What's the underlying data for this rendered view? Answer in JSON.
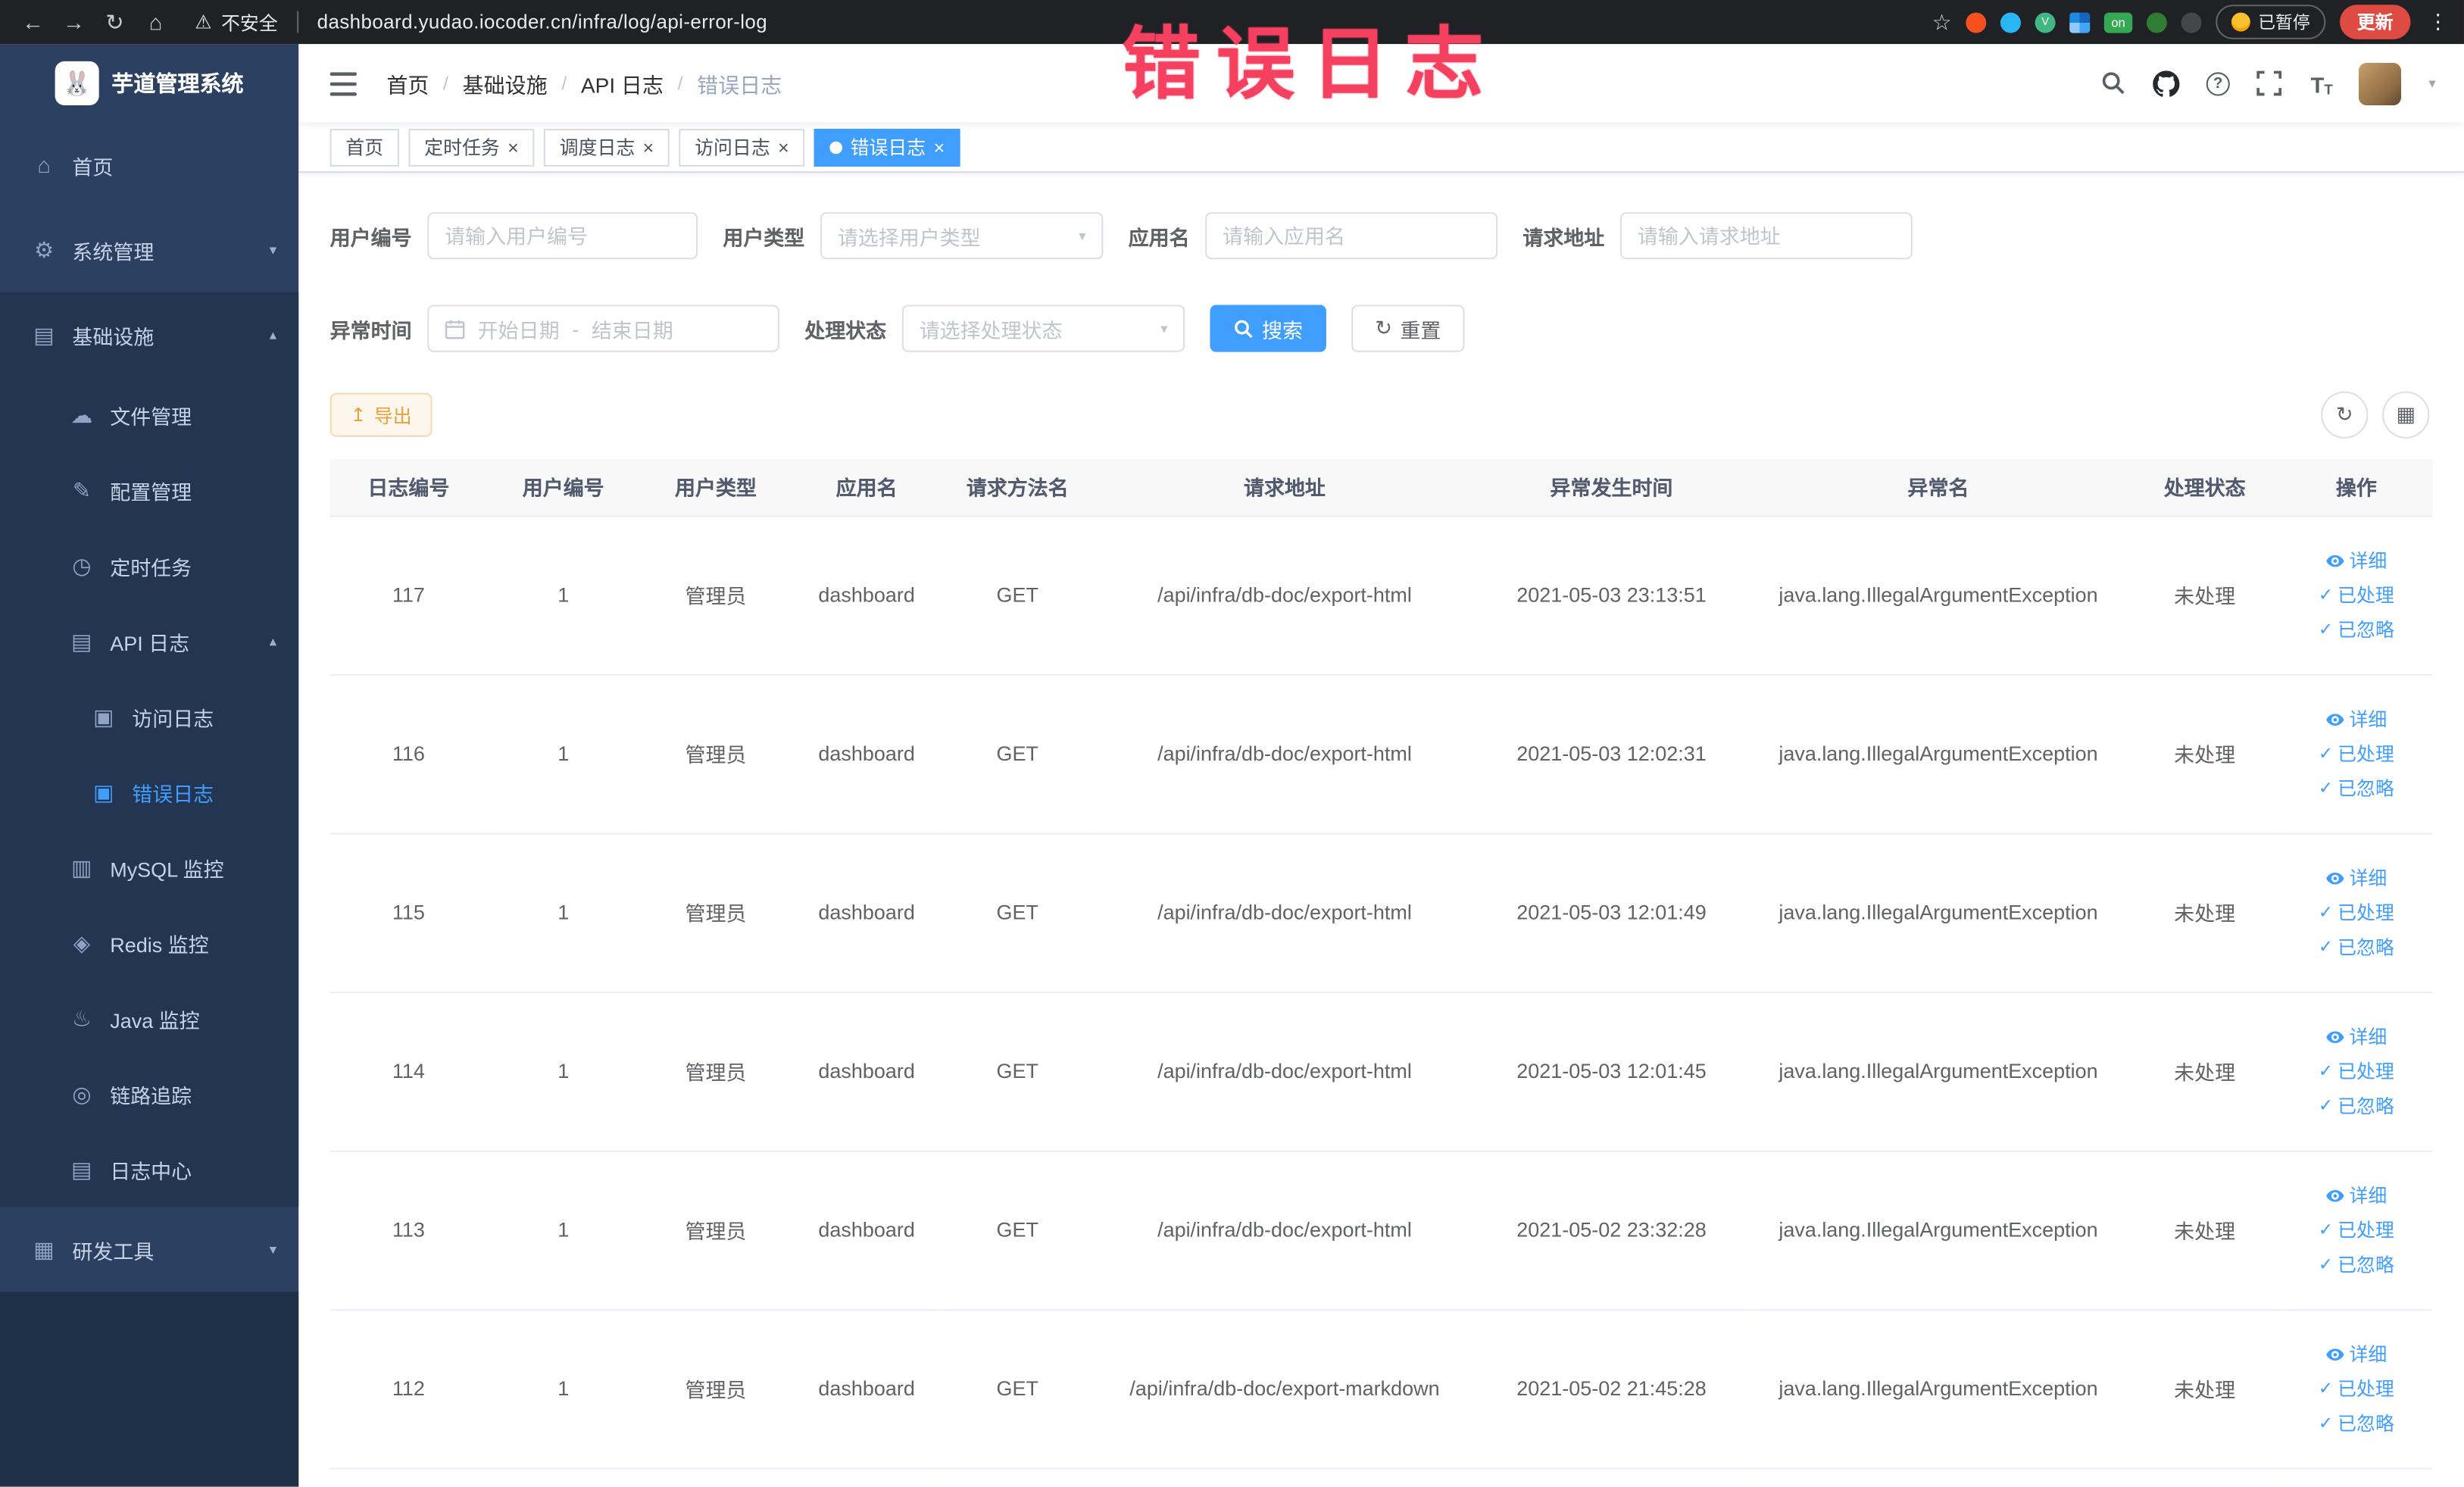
{
  "colors": {
    "accent": "#409eff",
    "annotation": "#f5405f",
    "warning": "#e6a23c",
    "sidebar_bg": "#2c4061"
  },
  "annotation": {
    "text": "错误日志"
  },
  "browser": {
    "security_label": "不安全",
    "url": "dashboard.yudao.iocoder.cn/infra/log/api-error-log",
    "ext_on": "on",
    "paused_label": "已暂停",
    "update_label": "更新"
  },
  "sidebar": {
    "logo_title": "芋道管理系统",
    "home": "首页",
    "system": "系统管理",
    "infra": "基础设施",
    "file": "文件管理",
    "config": "配置管理",
    "job": "定时任务",
    "api_log": "API 日志",
    "access_log": "访问日志",
    "error_log": "错误日志",
    "mysql": "MySQL 监控",
    "redis": "Redis 监控",
    "java": "Java 监控",
    "trace": "链路追踪",
    "log_center": "日志中心",
    "devtools": "研发工具"
  },
  "header": {
    "breadcrumb": [
      "首页",
      "基础设施",
      "API 日志",
      "错误日志"
    ]
  },
  "tabs": {
    "items": [
      {
        "label": "首页"
      },
      {
        "label": "定时任务"
      },
      {
        "label": "调度日志"
      },
      {
        "label": "访问日志"
      },
      {
        "label": "错误日志"
      }
    ]
  },
  "filters": {
    "user_id": {
      "label": "用户编号",
      "placeholder": "请输入用户编号",
      "value": ""
    },
    "user_type": {
      "label": "用户类型",
      "placeholder": "请选择用户类型"
    },
    "app_name": {
      "label": "应用名",
      "placeholder": "请输入应用名",
      "value": ""
    },
    "request_url": {
      "label": "请求地址",
      "placeholder": "请输入请求地址",
      "value": ""
    },
    "exception_time": {
      "label": "异常时间",
      "start_placeholder": "开始日期",
      "separator": "-",
      "end_placeholder": "结束日期"
    },
    "process_status": {
      "label": "处理状态",
      "placeholder": "请选择处理状态"
    },
    "search_label": "搜索",
    "reset_label": "重置"
  },
  "toolbar": {
    "export_label": "导出"
  },
  "table": {
    "columns": [
      "日志编号",
      "用户编号",
      "用户类型",
      "应用名",
      "请求方法名",
      "请求地址",
      "异常发生时间",
      "异常名",
      "处理状态",
      "操作"
    ],
    "action_labels": {
      "detail": "详细",
      "processed": "已处理",
      "ignored": "已忽略"
    },
    "rows": [
      {
        "id": "117",
        "user_id": "1",
        "user_type": "管理员",
        "app": "dashboard",
        "method": "GET",
        "url": "/api/infra/db-doc/export-html",
        "time": "2021-05-03 23:13:51",
        "exception": "java.lang.IllegalArgumentException",
        "status": "未处理"
      },
      {
        "id": "116",
        "user_id": "1",
        "user_type": "管理员",
        "app": "dashboard",
        "method": "GET",
        "url": "/api/infra/db-doc/export-html",
        "time": "2021-05-03 12:02:31",
        "exception": "java.lang.IllegalArgumentException",
        "status": "未处理"
      },
      {
        "id": "115",
        "user_id": "1",
        "user_type": "管理员",
        "app": "dashboard",
        "method": "GET",
        "url": "/api/infra/db-doc/export-html",
        "time": "2021-05-03 12:01:49",
        "exception": "java.lang.IllegalArgumentException",
        "status": "未处理"
      },
      {
        "id": "114",
        "user_id": "1",
        "user_type": "管理员",
        "app": "dashboard",
        "method": "GET",
        "url": "/api/infra/db-doc/export-html",
        "time": "2021-05-03 12:01:45",
        "exception": "java.lang.IllegalArgumentException",
        "status": "未处理"
      },
      {
        "id": "113",
        "user_id": "1",
        "user_type": "管理员",
        "app": "dashboard",
        "method": "GET",
        "url": "/api/infra/db-doc/export-html",
        "time": "2021-05-02 23:32:28",
        "exception": "java.lang.IllegalArgumentException",
        "status": "未处理"
      },
      {
        "id": "112",
        "user_id": "1",
        "user_type": "管理员",
        "app": "dashboard",
        "method": "GET",
        "url": "/api/infra/db-doc/export-markdown",
        "time": "2021-05-02 21:45:28",
        "exception": "java.lang.IllegalArgumentException",
        "status": "未处理"
      }
    ]
  }
}
